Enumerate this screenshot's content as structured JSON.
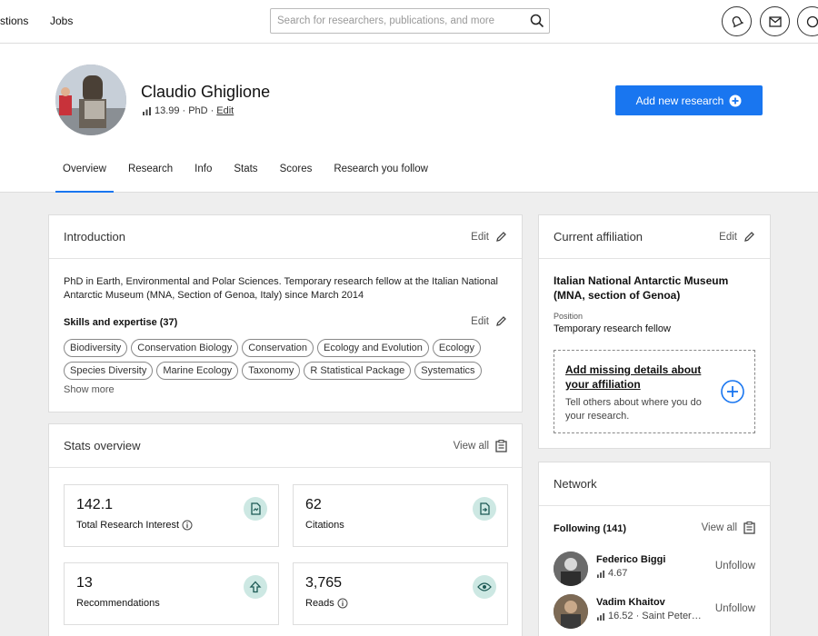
{
  "nav": {
    "links": [
      "stions",
      "Jobs"
    ],
    "search_placeholder": "Search for researchers, publications, and more"
  },
  "profile": {
    "name": "Claudio Ghiglione",
    "score": "13.99",
    "degree": "PhD",
    "edit_label": "Edit",
    "add_research_label": "Add new research"
  },
  "tabs": [
    "Overview",
    "Research",
    "Info",
    "Stats",
    "Scores",
    "Research you follow"
  ],
  "introduction": {
    "title": "Introduction",
    "edit_label": "Edit",
    "text": "PhD in Earth, Environmental and Polar Sciences. Temporary research fellow at the Italian National Antarctic Museum (MNA, Section of Genoa, Italy) since March 2014",
    "skills_title": "Skills and expertise (37)",
    "skills_edit": "Edit",
    "skills": [
      "Biodiversity",
      "Conservation Biology",
      "Conservation",
      "Ecology and Evolution",
      "Ecology",
      "Species Diversity",
      "Marine Ecology",
      "Taxonomy",
      "R Statistical Package",
      "Systematics"
    ],
    "show_more": "Show more"
  },
  "stats": {
    "title": "Stats overview",
    "view_all": "View all",
    "items": [
      {
        "value": "142.1",
        "label": "Total Research Interest",
        "icon": "research-interest-icon"
      },
      {
        "value": "62",
        "label": "Citations",
        "icon": "citations-icon"
      },
      {
        "value": "13",
        "label": "Recommendations",
        "icon": "recommend-icon"
      },
      {
        "value": "3,765",
        "label": "Reads",
        "icon": "eye-icon"
      }
    ]
  },
  "affiliation": {
    "title": "Current affiliation",
    "edit_label": "Edit",
    "institution": "Italian National Antarctic Museum (MNA, section of Genoa)",
    "position_label": "Position",
    "position": "Temporary research fellow",
    "missing_title": "Add missing details about your affiliation",
    "missing_desc": "Tell others about where you do your research."
  },
  "network": {
    "title": "Network",
    "following_label": "Following (141)",
    "view_all": "View all",
    "people": [
      {
        "name": "Federico Biggi",
        "meta": "4.67",
        "action": "Unfollow"
      },
      {
        "name": "Vadim Khaitov",
        "meta": "16.52 · Saint Peter…",
        "action": "Unfollow"
      }
    ]
  },
  "colors": {
    "accent": "#1976f0",
    "stat_icon_bg": "#cde8e3"
  }
}
